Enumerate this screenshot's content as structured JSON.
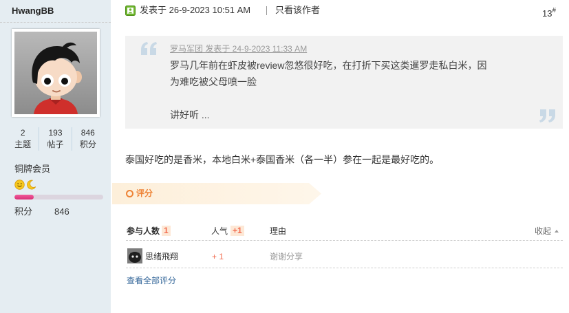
{
  "colors": {
    "sidebar_bg": "#E5EDF2",
    "accent": "#F26C4F",
    "link": "#336699",
    "rate": "#EE8336"
  },
  "sidebar": {
    "username": "HwangBB",
    "avatar": "cartoon-boy-avatar",
    "stats": [
      {
        "value": "2",
        "label": "主题"
      },
      {
        "value": "193",
        "label": "帖子"
      },
      {
        "value": "846",
        "label": "积分"
      }
    ],
    "rank": "铜牌会员",
    "rank_icons": [
      "smiley-icon",
      "moon-icon"
    ],
    "level_progress": 0.22,
    "points_label": "积分",
    "points_value": "846"
  },
  "post": {
    "status_icon": "online-user-icon",
    "posted": "发表于 26-9-2023 10:51 AM",
    "only_author": "只看该作者",
    "floor": "13",
    "floor_suffix": "#",
    "quote": {
      "meta": "罗马军团 发表于 24-9-2023 11:33 AM",
      "lines": [
        "罗马几年前在虾皮被review忽悠很好吃，在打折下买这类暹罗走私白米，因",
        "为难吃被父母喷一脸"
      ],
      "tail": "讲好听 ..."
    },
    "body": "泰国好吃的是香米，本地白米+泰国香米（各一半）参在一起是最好吃的。"
  },
  "rating": {
    "title": "评分",
    "participants_label": "参与人数",
    "participants_count": "1",
    "popularity_label": "人气",
    "popularity_value": "+1",
    "reason_label": "理由",
    "collapse_label": "收起",
    "rows": [
      {
        "user": "思绪飛翔",
        "score": "+ 1",
        "reason": "谢谢分享"
      }
    ],
    "view_all": "查看全部评分"
  }
}
